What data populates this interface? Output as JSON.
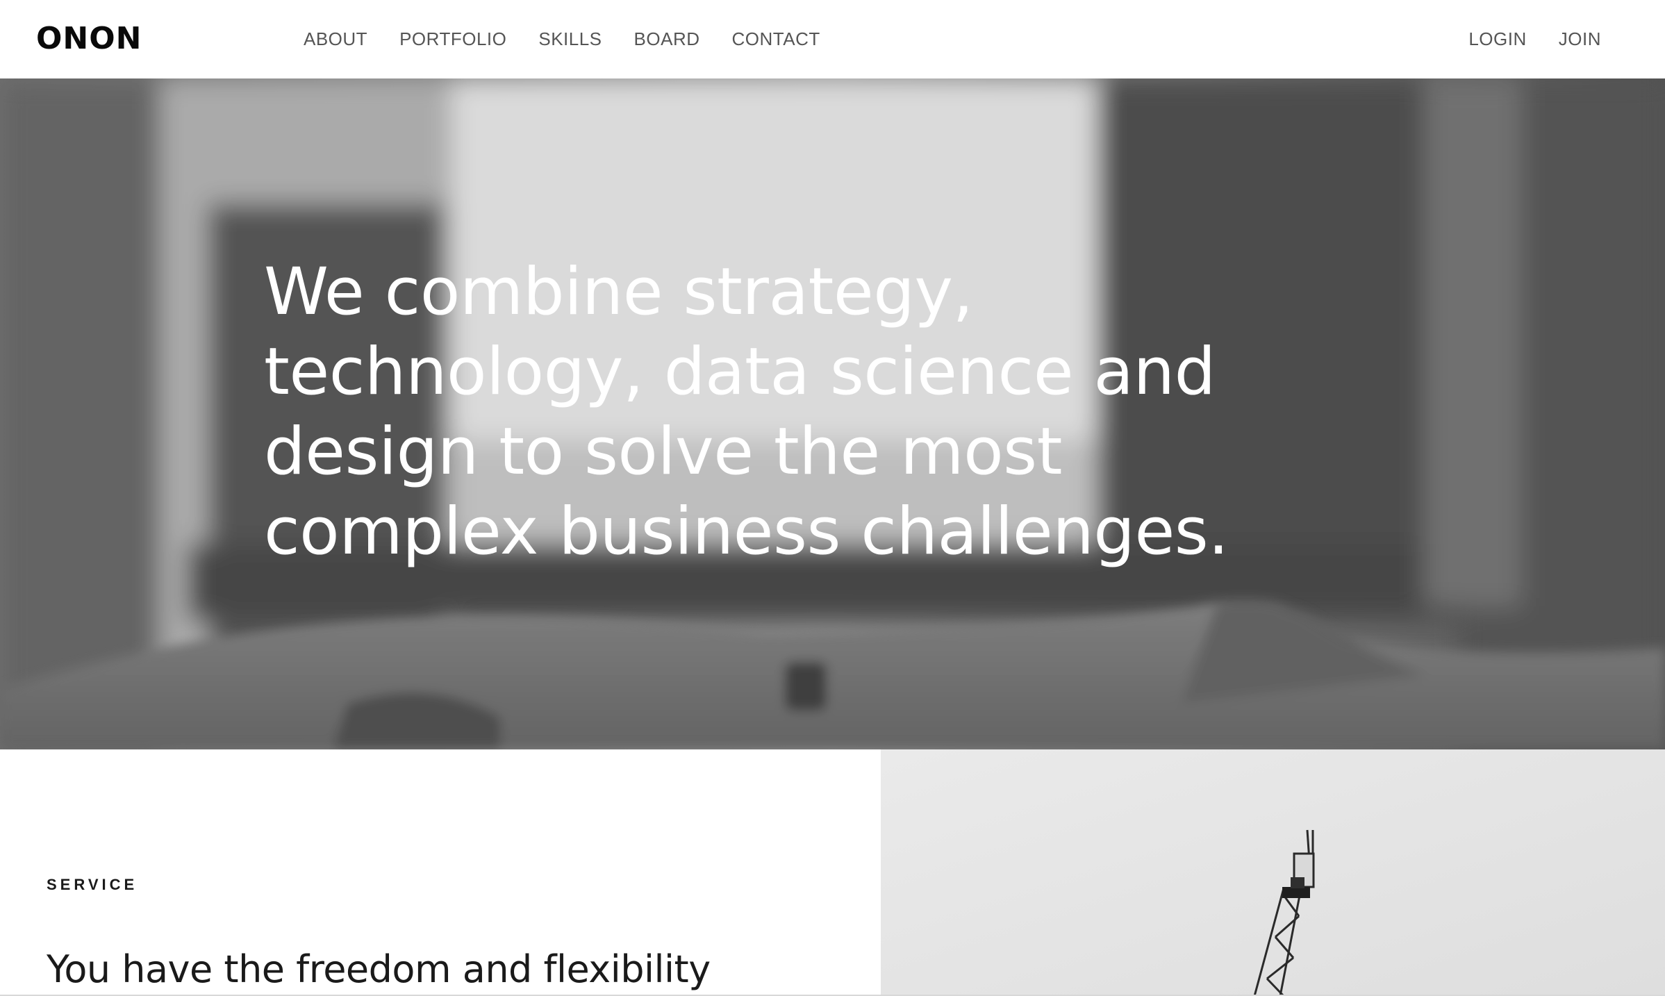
{
  "header": {
    "logo": "ONON",
    "nav": [
      "ABOUT",
      "PORTFOLIO",
      "SKILLS",
      "BOARD",
      "CONTACT"
    ],
    "auth": {
      "login": "LOGIN",
      "join": "JOIN"
    }
  },
  "hero": {
    "lines": [
      "We combine strategy,",
      "technology, data science and",
      "design to solve the most",
      "complex business challenges."
    ]
  },
  "service": {
    "label": "SERVICE",
    "heading": "You have the freedom and flexibility"
  }
}
